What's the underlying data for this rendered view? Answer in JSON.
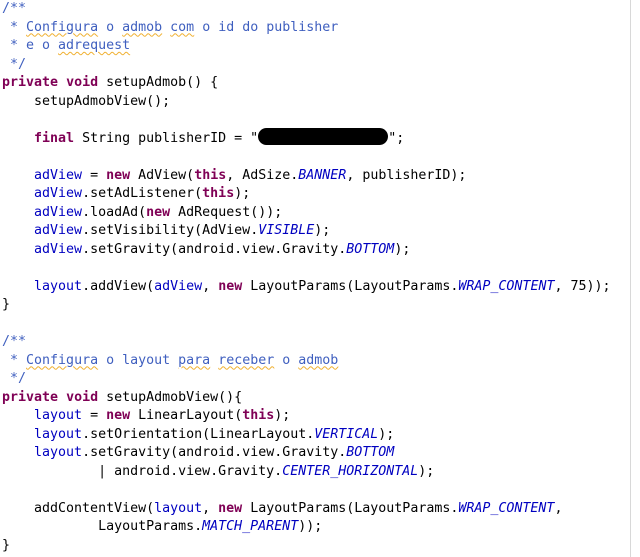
{
  "editor": {
    "language": "java",
    "colors": {
      "keyword": "#7f0055",
      "comment": "#3f5fbf",
      "field": "#0000c0",
      "static_field": "#0000c0",
      "text": "#000000",
      "squiggle": "#f0b030"
    },
    "lines": [
      {
        "tokens": [
          {
            "t": "/**",
            "c": "cm"
          }
        ]
      },
      {
        "tokens": [
          {
            "t": " * ",
            "c": "cm"
          },
          {
            "t": "Configura",
            "c": "cm",
            "sq": true
          },
          {
            "t": " o ",
            "c": "cm"
          },
          {
            "t": "admob",
            "c": "cm",
            "sq": true
          },
          {
            "t": " ",
            "c": "cm"
          },
          {
            "t": "com",
            "c": "cm",
            "sq": true
          },
          {
            "t": " o id do publisher",
            "c": "cm"
          }
        ]
      },
      {
        "tokens": [
          {
            "t": " * e o ",
            "c": "cm"
          },
          {
            "t": "adrequest",
            "c": "cm",
            "sq": true
          }
        ]
      },
      {
        "tokens": [
          {
            "t": " */",
            "c": "cm"
          }
        ]
      },
      {
        "tokens": [
          {
            "t": "private",
            "c": "kw"
          },
          {
            "t": " "
          },
          {
            "t": "void",
            "c": "kw"
          },
          {
            "t": " setupAdmob() {"
          }
        ]
      },
      {
        "tokens": [
          {
            "t": "    setupAdmobView();"
          }
        ]
      },
      {
        "tokens": []
      },
      {
        "tokens": [
          {
            "t": "    "
          },
          {
            "t": "final",
            "c": "kw"
          },
          {
            "t": " String publisherID = \""
          },
          {
            "redact": true,
            "redacted_value": "publisher-id"
          },
          {
            "t": "\";"
          }
        ]
      },
      {
        "tokens": []
      },
      {
        "tokens": [
          {
            "t": "    "
          },
          {
            "t": "adView",
            "c": "fd"
          },
          {
            "t": " = "
          },
          {
            "t": "new",
            "c": "kw"
          },
          {
            "t": " AdView("
          },
          {
            "t": "this",
            "c": "kw"
          },
          {
            "t": ", AdSize."
          },
          {
            "t": "BANNER",
            "c": "sf"
          },
          {
            "t": ", publisherID);"
          }
        ]
      },
      {
        "tokens": [
          {
            "t": "    "
          },
          {
            "t": "adView",
            "c": "fd"
          },
          {
            "t": ".setAdListener("
          },
          {
            "t": "this",
            "c": "kw"
          },
          {
            "t": ");"
          }
        ]
      },
      {
        "tokens": [
          {
            "t": "    "
          },
          {
            "t": "adView",
            "c": "fd"
          },
          {
            "t": ".loadAd("
          },
          {
            "t": "new",
            "c": "kw"
          },
          {
            "t": " AdRequest());"
          }
        ]
      },
      {
        "tokens": [
          {
            "t": "    "
          },
          {
            "t": "adView",
            "c": "fd"
          },
          {
            "t": ".setVisibility(AdView."
          },
          {
            "t": "VISIBLE",
            "c": "sf"
          },
          {
            "t": ");"
          }
        ]
      },
      {
        "tokens": [
          {
            "t": "    "
          },
          {
            "t": "adView",
            "c": "fd"
          },
          {
            "t": ".setGravity(android.view.Gravity."
          },
          {
            "t": "BOTTOM",
            "c": "sf"
          },
          {
            "t": ");"
          }
        ]
      },
      {
        "tokens": []
      },
      {
        "tokens": [
          {
            "t": "    "
          },
          {
            "t": "layout",
            "c": "fd"
          },
          {
            "t": ".addView("
          },
          {
            "t": "adView",
            "c": "fd"
          },
          {
            "t": ", "
          },
          {
            "t": "new",
            "c": "kw"
          },
          {
            "t": " LayoutParams(LayoutParams."
          },
          {
            "t": "WRAP_CONTENT",
            "c": "sf"
          },
          {
            "t": ", 75));"
          }
        ]
      },
      {
        "tokens": [
          {
            "t": "}"
          }
        ]
      },
      {
        "tokens": []
      },
      {
        "tokens": [
          {
            "t": "/**",
            "c": "cm"
          }
        ]
      },
      {
        "tokens": [
          {
            "t": " * ",
            "c": "cm"
          },
          {
            "t": "Configura",
            "c": "cm",
            "sq": true
          },
          {
            "t": " o layout ",
            "c": "cm"
          },
          {
            "t": "para",
            "c": "cm",
            "sq": true
          },
          {
            "t": " ",
            "c": "cm"
          },
          {
            "t": "receber",
            "c": "cm",
            "sq": true
          },
          {
            "t": " o ",
            "c": "cm"
          },
          {
            "t": "admob",
            "c": "cm",
            "sq": true
          }
        ]
      },
      {
        "tokens": [
          {
            "t": " */",
            "c": "cm"
          }
        ]
      },
      {
        "tokens": [
          {
            "t": "private",
            "c": "kw"
          },
          {
            "t": " "
          },
          {
            "t": "void",
            "c": "kw"
          },
          {
            "t": " setupAdmobView(){"
          }
        ]
      },
      {
        "tokens": [
          {
            "t": "    "
          },
          {
            "t": "layout",
            "c": "fd"
          },
          {
            "t": " = "
          },
          {
            "t": "new",
            "c": "kw"
          },
          {
            "t": " LinearLayout("
          },
          {
            "t": "this",
            "c": "kw"
          },
          {
            "t": ");"
          }
        ]
      },
      {
        "tokens": [
          {
            "t": "    "
          },
          {
            "t": "layout",
            "c": "fd"
          },
          {
            "t": ".setOrientation(LinearLayout."
          },
          {
            "t": "VERTICAL",
            "c": "sf"
          },
          {
            "t": ");"
          }
        ]
      },
      {
        "tokens": [
          {
            "t": "    "
          },
          {
            "t": "layout",
            "c": "fd"
          },
          {
            "t": ".setGravity(android.view.Gravity."
          },
          {
            "t": "BOTTOM",
            "c": "sf"
          }
        ]
      },
      {
        "tokens": [
          {
            "t": "            | android.view.Gravity."
          },
          {
            "t": "CENTER_HORIZONTAL",
            "c": "sf"
          },
          {
            "t": ");"
          }
        ]
      },
      {
        "tokens": []
      },
      {
        "tokens": [
          {
            "t": "    addContentView("
          },
          {
            "t": "layout",
            "c": "fd"
          },
          {
            "t": ", "
          },
          {
            "t": "new",
            "c": "kw"
          },
          {
            "t": " LayoutParams(LayoutParams."
          },
          {
            "t": "WRAP_CONTENT",
            "c": "sf"
          },
          {
            "t": ","
          }
        ]
      },
      {
        "tokens": [
          {
            "t": "            LayoutParams."
          },
          {
            "t": "MATCH_PARENT",
            "c": "sf"
          },
          {
            "t": "));"
          }
        ]
      },
      {
        "tokens": [
          {
            "t": "}"
          }
        ]
      }
    ]
  }
}
